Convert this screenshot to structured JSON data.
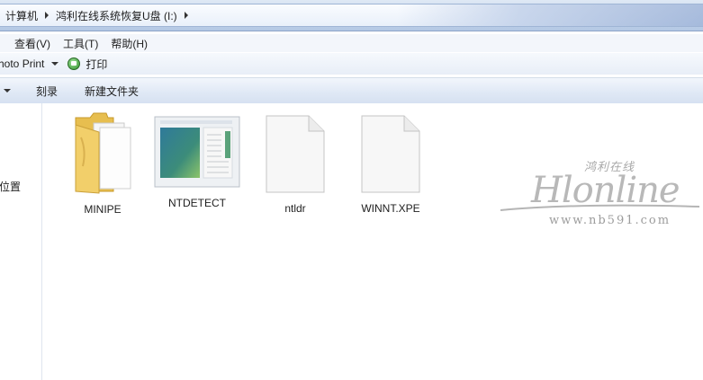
{
  "address": {
    "crumbs": [
      "计算机",
      "鸿利在线系统恢复U盘 (I:)"
    ]
  },
  "menu": [
    "查看(V)",
    "工具(T)",
    "帮助(H)"
  ],
  "toolbar": {
    "open_with_label": "hoto Print",
    "print_label": "打印"
  },
  "commands": [
    "刻录",
    "新建文件夹"
  ],
  "nav": {
    "partial_label": "位置"
  },
  "files": [
    {
      "name": "MINIPE",
      "type": "folder"
    },
    {
      "name": "NTDETECT",
      "type": "image"
    },
    {
      "name": "ntldr",
      "type": "document"
    },
    {
      "name": "WINNT.XPE",
      "type": "document"
    }
  ],
  "watermark": {
    "chinese": "鸿利在线",
    "brand": "Hlonline",
    "url": "www.nb591.com"
  },
  "colors": {
    "folder": "#f2cf6a",
    "command_bar": "#dfe8f5",
    "print_icon": "#2f8f2a"
  }
}
